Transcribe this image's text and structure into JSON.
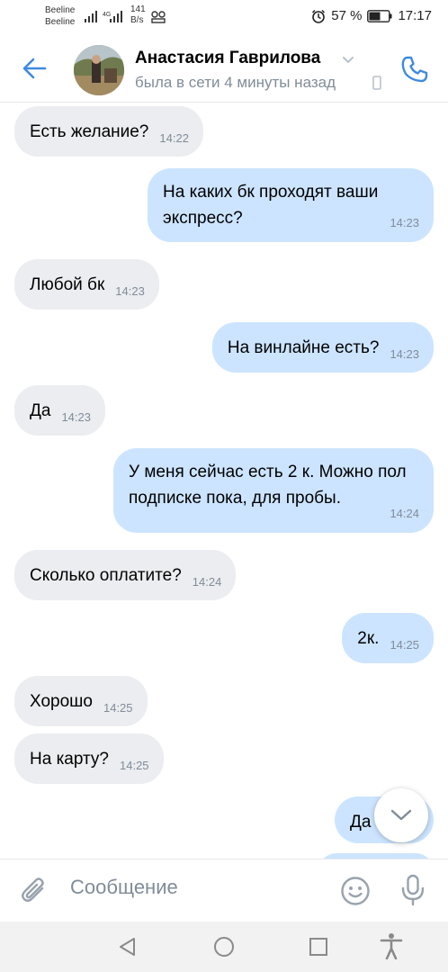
{
  "status_bar": {
    "carrier_1": "Beeline",
    "carrier_2": "Beeline",
    "network": "4G",
    "speed_value": "141",
    "speed_unit": "B/s",
    "battery": "57 %",
    "time": "17:17"
  },
  "header": {
    "contact_name": "Анастасия Гаврилова",
    "contact_status": "была в сети 4 минуты назад"
  },
  "messages": [
    {
      "dir": "in",
      "text": "Есть желание?",
      "time": "14:22"
    },
    {
      "dir": "out",
      "text": "На каких бк проходят ваши экспресс?",
      "time": "14:23"
    },
    {
      "dir": "in",
      "text": "Любой бк",
      "time": "14:23"
    },
    {
      "dir": "out",
      "text": "На винлайне есть?",
      "time": "14:23"
    },
    {
      "dir": "in",
      "text": "Да",
      "time": "14:23"
    },
    {
      "dir": "out",
      "text": "У меня сейчас есть 2 к. Можно пол подписке пока, для пробы.",
      "time": "14:24"
    },
    {
      "dir": "in",
      "text": "Сколько оплатите?",
      "time": "14:24"
    },
    {
      "dir": "out",
      "text": "2к.",
      "time": "14:25"
    },
    {
      "dir": "in",
      "text": "Хорошо",
      "time": "14:25"
    },
    {
      "dir": "in",
      "text": "На карту?",
      "time": "14:25"
    },
    {
      "dir": "out",
      "text": "Да",
      "time": ""
    }
  ],
  "composer": {
    "placeholder": "Сообщение"
  },
  "colors": {
    "accent": "#3f8ae0",
    "incoming_bubble": "#ebedf0",
    "outgoing_bubble": "#cce4ff",
    "secondary_text": "#818c99"
  },
  "icons": {
    "back": "arrow-left-icon",
    "call": "phone-icon",
    "attach": "paperclip-icon",
    "emoji": "smile-icon",
    "mic": "microphone-icon",
    "scroll": "chevron-down-icon"
  }
}
